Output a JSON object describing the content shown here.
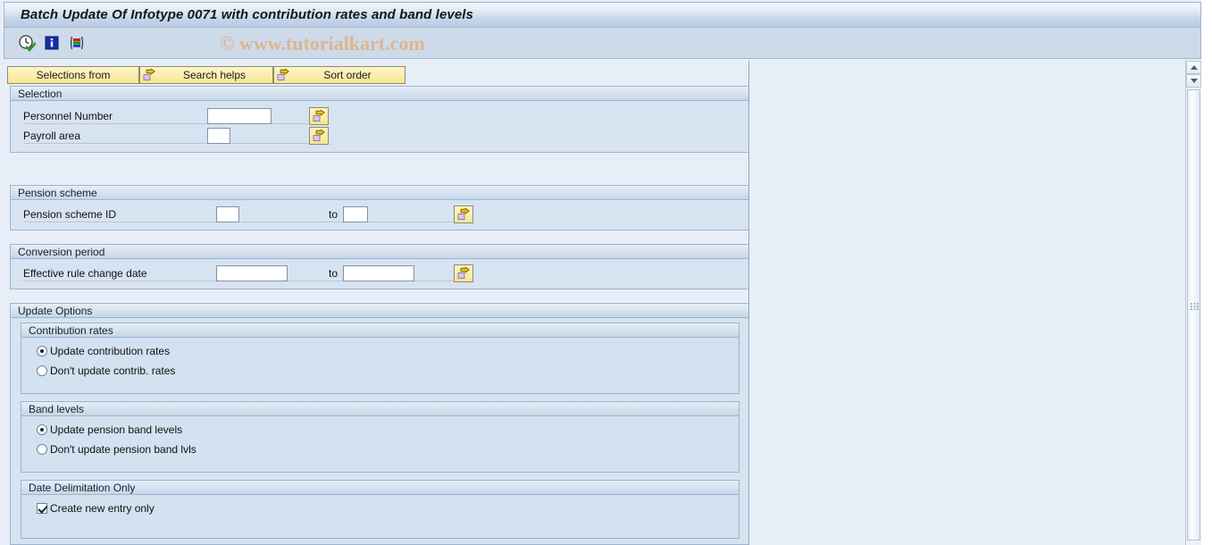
{
  "window": {
    "title": "Batch Update Of Infotype 0071 with contribution rates and band levels",
    "watermark": "© www.tutorialkart.com"
  },
  "toolbar": {
    "icons": [
      {
        "name": "execute-clock-icon",
        "tooltip": "Execute"
      },
      {
        "name": "info-icon",
        "tooltip": "Information"
      },
      {
        "name": "color-bars-icon",
        "tooltip": "Variants"
      }
    ]
  },
  "buttonbar": {
    "selections_from": "Selections from",
    "search_helps": "Search helps",
    "sort_order": "Sort order"
  },
  "sections": {
    "selection": {
      "title": "Selection",
      "fields": [
        {
          "label": "Personnel Number",
          "value": "",
          "multi": "multi-select-arrow-icon"
        },
        {
          "label": "Payroll area",
          "value": "",
          "multi": "multi-select-arrow-icon"
        }
      ]
    },
    "pension_scheme": {
      "title": "Pension scheme",
      "field_label": "Pension scheme ID",
      "from_value": "",
      "to_word": "to",
      "to_value": "",
      "multi": "multi-select-arrow-icon"
    },
    "conversion_period": {
      "title": "Conversion period",
      "field_label": "Effective rule change date",
      "from_value": "",
      "to_word": "to",
      "to_value": "",
      "multi": "multi-select-arrow-icon"
    },
    "update_options": {
      "title": "Update Options",
      "contribution_rates": {
        "title": "Contribution rates",
        "options": [
          {
            "label": "Update contribution rates",
            "selected": true
          },
          {
            "label": "Don't update contrib. rates",
            "selected": false
          }
        ]
      },
      "band_levels": {
        "title": "Band levels",
        "options": [
          {
            "label": "Update pension band levels",
            "selected": true
          },
          {
            "label": "Don't update pension band lvls",
            "selected": false
          }
        ]
      },
      "date_delimitation": {
        "title": "Date Delimitation Only",
        "checkbox": {
          "label": "Create new entry only",
          "checked": true
        }
      }
    }
  },
  "scrollbar": {
    "up_icon": "scroll-up-arrow-icon",
    "down_icon": "scroll-down-arrow-icon"
  },
  "colors": {
    "title_bar": "#c3d4e8",
    "toolbar": "#ccdaea",
    "group_bg": "#d7e3f0",
    "page_bg": "#e8eef7",
    "button_yellow": "#fbeeae",
    "watermark": "#e0b285"
  }
}
